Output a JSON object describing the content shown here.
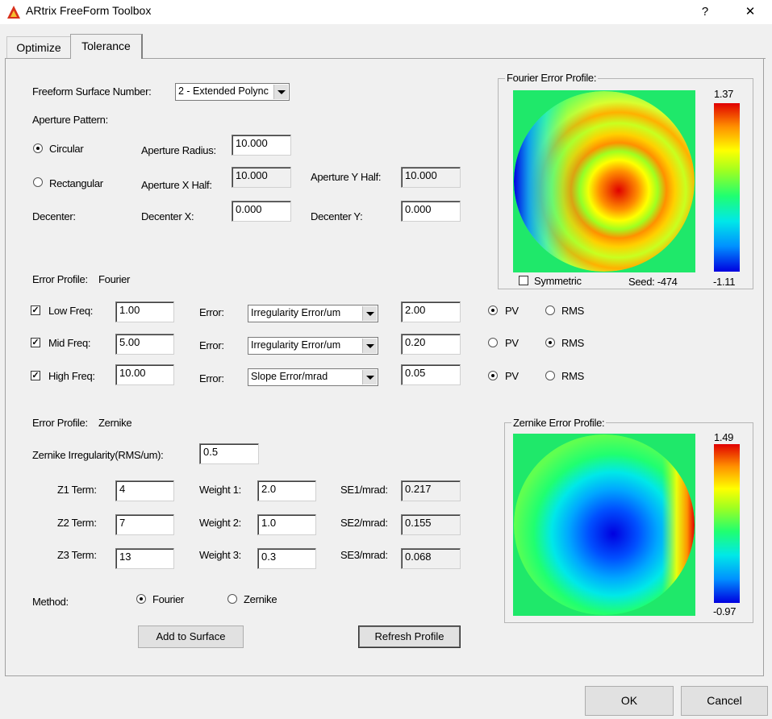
{
  "window": {
    "title": "ARtrix FreeForm Toolbox",
    "help_label": "?",
    "close_label": "✕"
  },
  "tabs": [
    {
      "label": "Optimize",
      "active": false
    },
    {
      "label": "Tolerance",
      "active": true
    }
  ],
  "surface": {
    "label": "Freeform Surface Number:",
    "selected": "2 - Extended Polync"
  },
  "aperture": {
    "pattern_label": "Aperture Pattern:",
    "circular_label": "Circular",
    "circular_selected": true,
    "rectangular_label": "Rectangular",
    "rectangular_selected": false,
    "radius_label": "Aperture Radius:",
    "radius_value": "10.000",
    "xhalf_label": "Aperture X Half:",
    "xhalf_value": "10.000",
    "yhalf_label": "Aperture Y Half:",
    "yhalf_value": "10.000",
    "decenter_label": "Decenter:",
    "decx_label": "Decenter X:",
    "decx_value": "0.000",
    "decy_label": "Decenter Y:",
    "decy_value": "0.000"
  },
  "fourier": {
    "heading": "Error Profile:",
    "heading_value": "Fourier",
    "error_label": "Error:",
    "pv_label": "PV",
    "rms_label": "RMS",
    "rows": [
      {
        "label": "Low Freq:",
        "checked": true,
        "freq": "1.00",
        "type": "Irregularity Error/um",
        "value": "2.00",
        "pv": true
      },
      {
        "label": "Mid Freq:",
        "checked": true,
        "freq": "5.00",
        "type": "Irregularity Error/um",
        "value": "0.20",
        "pv": false
      },
      {
        "label": "High Freq:",
        "checked": true,
        "freq": "10.00",
        "type": "Slope Error/mrad",
        "value": "0.05",
        "pv": true
      }
    ]
  },
  "zernike": {
    "heading": "Error Profile:",
    "heading_value": "Zernike",
    "irregularity_label": "Zernike Irregularity(RMS/um):",
    "irregularity_value": "0.5",
    "terms": [
      {
        "term_label": "Z1 Term:",
        "term": "4",
        "weight_label": "Weight 1:",
        "weight": "2.0",
        "se_label": "SE1/mrad:",
        "se": "0.217"
      },
      {
        "term_label": "Z2 Term:",
        "term": "7",
        "weight_label": "Weight 2:",
        "weight": "1.0",
        "se_label": "SE2/mrad:",
        "se": "0.155"
      },
      {
        "term_label": "Z3 Term:",
        "term": "13",
        "weight_label": "Weight 3:",
        "weight": "0.3",
        "se_label": "SE3/mrad:",
        "se": "0.068"
      }
    ]
  },
  "method": {
    "label": "Method:",
    "fourier_label": "Fourier",
    "zernike_label": "Zernike",
    "selected": "Fourier"
  },
  "actions": {
    "add_label": "Add to Surface",
    "refresh_label": "Refresh Profile",
    "ok_label": "OK",
    "cancel_label": "Cancel"
  },
  "fourier_profile": {
    "title": "Fourier Error Profile:",
    "max": "1.37",
    "min": "-1.11",
    "symmetric_label": "Symmetric",
    "symmetric_checked": false,
    "seed_text": "Seed: -474"
  },
  "zernike_profile": {
    "title": "Zernike Error Profile:",
    "max": "1.49",
    "min": "-0.97"
  },
  "colors": {
    "map_background": "#1fe86a",
    "colormap": [
      "#0000e0",
      "#0090ff",
      "#00e8e8",
      "#20ff70",
      "#a0ff20",
      "#ffff00",
      "#ff9000",
      "#e00000"
    ]
  }
}
